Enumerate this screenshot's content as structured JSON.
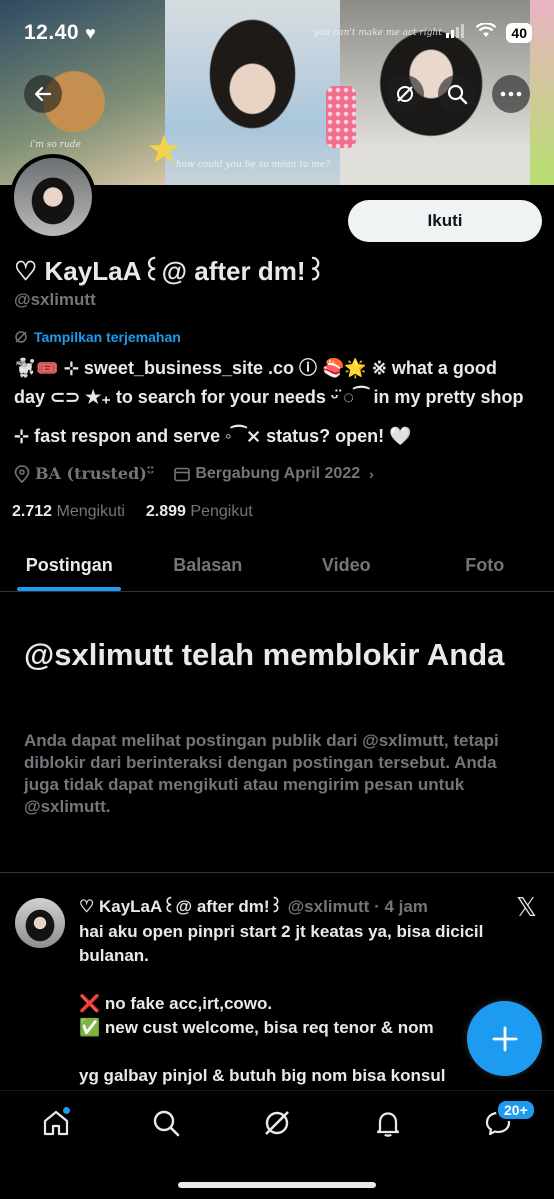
{
  "status_bar": {
    "time": "12.40",
    "heart": "♥",
    "battery": "40"
  },
  "banner": {
    "text1": "you can't make me act right",
    "text2": "i'm so rude",
    "text3": "how could you be so mean to me?"
  },
  "profile": {
    "follow_label": "Ikuti",
    "name": "♡ KayLaA꒰@ after dm!꒱",
    "handle": "@sxlimutt",
    "translate_label": "Tampilkan terjemahan",
    "bio_line1": "🐩🎟️ ⊹ sweet_business_site .co ⓘ 🍣🌟 ※ what a good",
    "bio_line2": "day ⊂⊃ ★₊ to search for your needs ᵕ̈ ◌⁀ in my pretty shop",
    "bio_line3": "⊹ fast respon and serve ◦⁀⨯ status? open! 🤍",
    "location": "BA (trusted)ᵕ̈",
    "joined": "Bergabung April 2022",
    "following_count": "2.712",
    "following_label": "Mengikuti",
    "followers_count": "2.899",
    "followers_label": "Pengikut"
  },
  "tabs": [
    {
      "label": "Postingan"
    },
    {
      "label": "Balasan"
    },
    {
      "label": "Video"
    },
    {
      "label": "Foto"
    }
  ],
  "blocked": {
    "title": "@sxlimutt telah memblokir Anda",
    "description": "Anda dapat melihat postingan publik dari @sxlimutt, tetapi diblokir dari berinteraksi dengan postingan tersebut. Anda juga tidak dapat mengikuti atau mengirim pesan untuk @sxlimutt."
  },
  "post": {
    "name": "♡ KayLaA꒰@ after dm!꒱",
    "meta": "@sxlimutt · 4 jam",
    "body": "hai aku open pinpri start 2 jt keatas ya, bisa dicicil bulanan.\n\n❌ no fake acc,irt,cowo.\n✅ new cust welcome, bisa req tenor & nom\n\nyg galbay pinjol & butuh big nom bisa konsul"
  },
  "nav": {
    "messages_badge": "20+"
  },
  "colors": {
    "accent": "#1d9bf0",
    "background": "#000000",
    "muted": "#71767b"
  }
}
